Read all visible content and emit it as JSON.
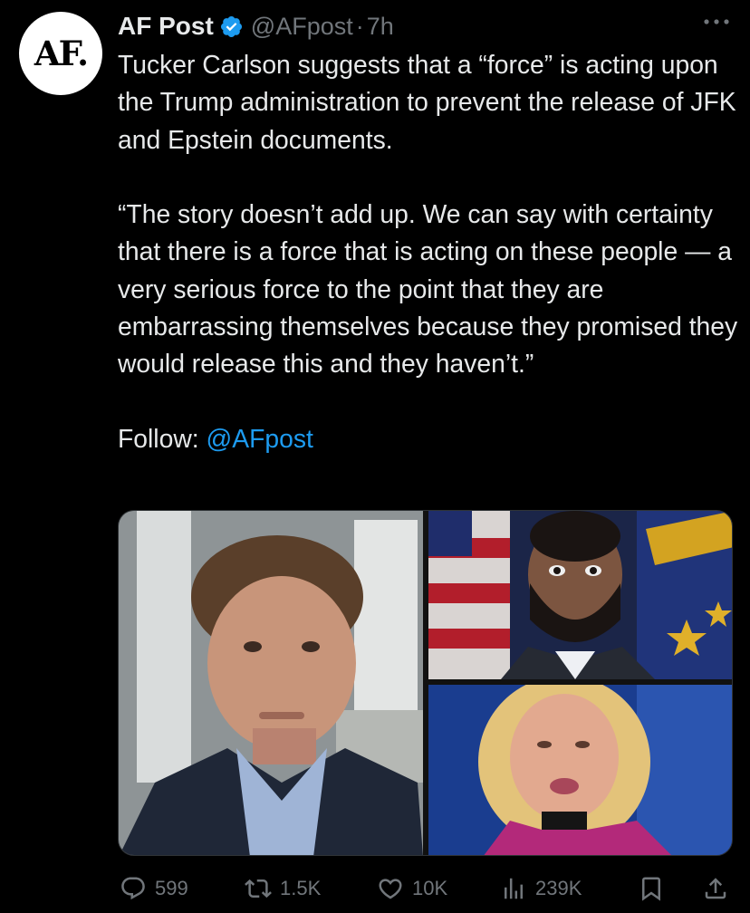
{
  "author": {
    "avatar_text": "AF.",
    "name": "AF Post",
    "handle": "@AFpost",
    "separator": "·",
    "time": "7h",
    "verified": true
  },
  "tweet": {
    "paragraph1": "Tucker Carlson suggests that a “force” is acting upon the Trump administration to prevent the release of JFK and Epstein documents.",
    "paragraph2": "“The story doesn’t add up. We can say with certainty that there is a force that is acting on these people — a very serious force to the point that they are embarrassing themselves because they promised they would release this and they haven’t.”",
    "follow_label": "Follow: ",
    "follow_link": "@AFpost"
  },
  "media": [
    {
      "name": "photo-tucker-carlson"
    },
    {
      "name": "photo-man-with-flag"
    },
    {
      "name": "photo-blonde-woman"
    }
  ],
  "actions": {
    "replies": "599",
    "reposts": "1.5K",
    "likes": "10K",
    "views": "239K"
  },
  "colors": {
    "background": "#000000",
    "text": "#e7e9ea",
    "muted": "#71767b",
    "link": "#1d9bf0",
    "verified": "#1d9bf0"
  },
  "icons": [
    "more-icon",
    "verified-badge-icon",
    "reply-icon",
    "repost-icon",
    "like-icon",
    "views-icon",
    "bookmark-icon",
    "share-icon"
  ]
}
